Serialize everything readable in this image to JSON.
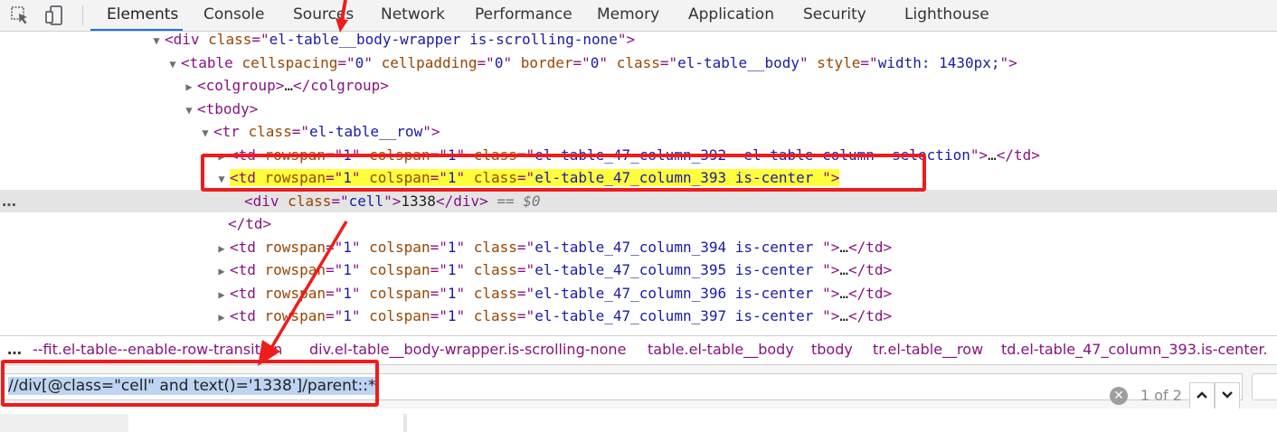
{
  "toolbar": {
    "tabs": [
      "Elements",
      "Console",
      "Sources",
      "Network",
      "Performance",
      "Memory",
      "Application",
      "Security",
      "Lighthouse"
    ],
    "active_tab": "Elements"
  },
  "tree": {
    "lines": [
      {
        "tri": "▼",
        "parts": [
          [
            "tag",
            "<div "
          ],
          [
            "attr",
            "class"
          ],
          [
            "tag",
            "=\""
          ],
          [
            "val",
            "el-table__body-wrapper is-scrolling-none"
          ],
          [
            "tag",
            "\">"
          ]
        ]
      },
      {
        "tri": "▼",
        "parts": [
          [
            "tag",
            "<table "
          ],
          [
            "attr",
            "cellspacing"
          ],
          [
            "tag",
            "=\""
          ],
          [
            "val",
            "0"
          ],
          [
            "tag",
            "\" "
          ],
          [
            "attr",
            "cellpadding"
          ],
          [
            "tag",
            "=\""
          ],
          [
            "val",
            "0"
          ],
          [
            "tag",
            "\" "
          ],
          [
            "attr",
            "border"
          ],
          [
            "tag",
            "=\""
          ],
          [
            "val",
            "0"
          ],
          [
            "tag",
            "\" "
          ],
          [
            "attr",
            "class"
          ],
          [
            "tag",
            "=\""
          ],
          [
            "val",
            "el-table__body"
          ],
          [
            "tag",
            "\" "
          ],
          [
            "attr",
            "style"
          ],
          [
            "tag",
            "=\""
          ],
          [
            "val",
            "width: 1430px;"
          ],
          [
            "tag",
            "\">"
          ]
        ]
      },
      {
        "tri": "▶",
        "parts": [
          [
            "tag",
            "<colgroup>"
          ],
          [
            "txt",
            "…"
          ],
          [
            "tag",
            "</colgroup>"
          ]
        ]
      },
      {
        "tri": "▼",
        "parts": [
          [
            "tag",
            "<tbody>"
          ]
        ]
      },
      {
        "tri": "▼",
        "parts": [
          [
            "tag",
            "<tr "
          ],
          [
            "attr",
            "class"
          ],
          [
            "tag",
            "=\""
          ],
          [
            "val",
            "el-table__row"
          ],
          [
            "tag",
            "\">"
          ]
        ]
      },
      {
        "tri": "▶",
        "parts": [
          [
            "tag",
            "<td "
          ],
          [
            "attr",
            "rowspan"
          ],
          [
            "tag",
            "=\""
          ],
          [
            "val",
            "1"
          ],
          [
            "tag",
            "\" "
          ],
          [
            "attr",
            "colspan"
          ],
          [
            "tag",
            "=\""
          ],
          [
            "val",
            "1"
          ],
          [
            "tag",
            "\" "
          ],
          [
            "attr",
            "class"
          ],
          [
            "tag",
            "=\""
          ],
          [
            "val",
            "el-table_47_column_392  el-table-column--selection"
          ],
          [
            "tag",
            "\">"
          ],
          [
            "txt",
            "…"
          ],
          [
            "tag",
            "</td>"
          ]
        ]
      },
      {
        "tri": "▼",
        "highlight": true,
        "parts": [
          [
            "tag",
            "<td "
          ],
          [
            "attr",
            "rowspan"
          ],
          [
            "tag",
            "=\""
          ],
          [
            "val",
            "1"
          ],
          [
            "tag",
            "\" "
          ],
          [
            "attr",
            "colspan"
          ],
          [
            "tag",
            "=\""
          ],
          [
            "val",
            "1"
          ],
          [
            "tag",
            "\" "
          ],
          [
            "attr",
            "class"
          ],
          [
            "tag",
            "=\""
          ],
          [
            "val",
            "el-table_47_column_393 is-center "
          ],
          [
            "tag",
            "\">"
          ]
        ]
      },
      {
        "tri": "",
        "selected": true,
        "parts": [
          [
            "tag",
            "<div "
          ],
          [
            "attr",
            "class"
          ],
          [
            "tag",
            "=\""
          ],
          [
            "val",
            "cell"
          ],
          [
            "tag",
            "\">"
          ],
          [
            "txt",
            "1338"
          ],
          [
            "tag",
            "</div>"
          ],
          [
            "sel",
            " == $0"
          ]
        ]
      },
      {
        "tri": "",
        "parts": [
          [
            "tag",
            "</td>"
          ]
        ]
      },
      {
        "tri": "▶",
        "parts": [
          [
            "tag",
            "<td "
          ],
          [
            "attr",
            "rowspan"
          ],
          [
            "tag",
            "=\""
          ],
          [
            "val",
            "1"
          ],
          [
            "tag",
            "\" "
          ],
          [
            "attr",
            "colspan"
          ],
          [
            "tag",
            "=\""
          ],
          [
            "val",
            "1"
          ],
          [
            "tag",
            "\" "
          ],
          [
            "attr",
            "class"
          ],
          [
            "tag",
            "=\""
          ],
          [
            "val",
            "el-table_47_column_394 is-center "
          ],
          [
            "tag",
            "\">"
          ],
          [
            "txt",
            "…"
          ],
          [
            "tag",
            "</td>"
          ]
        ]
      },
      {
        "tri": "▶",
        "parts": [
          [
            "tag",
            "<td "
          ],
          [
            "attr",
            "rowspan"
          ],
          [
            "tag",
            "=\""
          ],
          [
            "val",
            "1"
          ],
          [
            "tag",
            "\" "
          ],
          [
            "attr",
            "colspan"
          ],
          [
            "tag",
            "=\""
          ],
          [
            "val",
            "1"
          ],
          [
            "tag",
            "\" "
          ],
          [
            "attr",
            "class"
          ],
          [
            "tag",
            "=\""
          ],
          [
            "val",
            "el-table_47_column_395 is-center "
          ],
          [
            "tag",
            "\">"
          ],
          [
            "txt",
            "…"
          ],
          [
            "tag",
            "</td>"
          ]
        ]
      },
      {
        "tri": "▶",
        "parts": [
          [
            "tag",
            "<td "
          ],
          [
            "attr",
            "rowspan"
          ],
          [
            "tag",
            "=\""
          ],
          [
            "val",
            "1"
          ],
          [
            "tag",
            "\" "
          ],
          [
            "attr",
            "colspan"
          ],
          [
            "tag",
            "=\""
          ],
          [
            "val",
            "1"
          ],
          [
            "tag",
            "\" "
          ],
          [
            "attr",
            "class"
          ],
          [
            "tag",
            "=\""
          ],
          [
            "val",
            "el-table_47_column_396 is-center "
          ],
          [
            "tag",
            "\">"
          ],
          [
            "txt",
            "…"
          ],
          [
            "tag",
            "</td>"
          ]
        ]
      },
      {
        "tri": "▶",
        "parts": [
          [
            "tag",
            "<td "
          ],
          [
            "attr",
            "rowspan"
          ],
          [
            "tag",
            "=\""
          ],
          [
            "val",
            "1"
          ],
          [
            "tag",
            "\" "
          ],
          [
            "attr",
            "colspan"
          ],
          [
            "tag",
            "=\""
          ],
          [
            "val",
            "1"
          ],
          [
            "tag",
            "\" "
          ],
          [
            "attr",
            "class"
          ],
          [
            "tag",
            "=\""
          ],
          [
            "val",
            "el-table_47_column_397 is-center "
          ],
          [
            "tag",
            "\">"
          ],
          [
            "txt",
            "…"
          ],
          [
            "tag",
            "</td>"
          ]
        ]
      }
    ]
  },
  "breadcrumbs": {
    "items": [
      "--fit.el-table--enable-row-transition",
      "div.el-table__body-wrapper.is-scrolling-none",
      "table.el-table__body",
      "tbody",
      "tr.el-table__row",
      "td.el-table_47_column_393.is-center."
    ]
  },
  "search": {
    "query": "//div[@class=\"cell\" and text()='1338']/parent::*",
    "match_count": "1 of 2"
  }
}
